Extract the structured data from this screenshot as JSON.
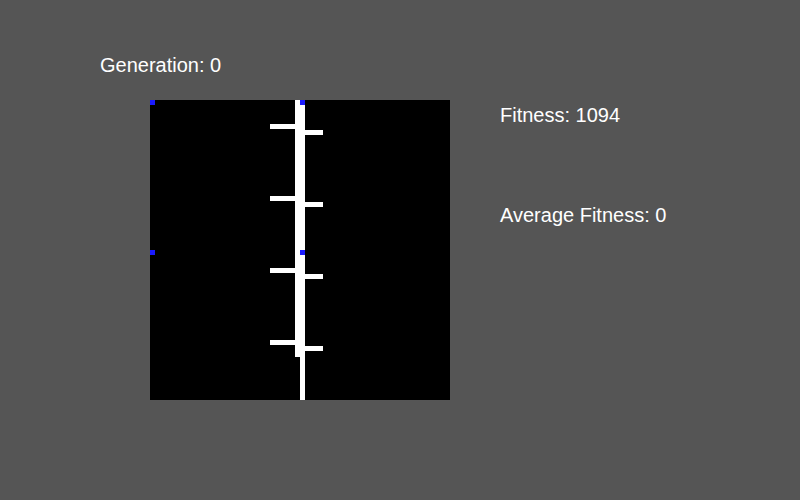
{
  "generation": {
    "label": "Generation: 0"
  },
  "stats": {
    "fitness": "Fitness: 1094",
    "average_fitness": "Average Fitness: 0"
  },
  "creature": {
    "legs": 4
  }
}
